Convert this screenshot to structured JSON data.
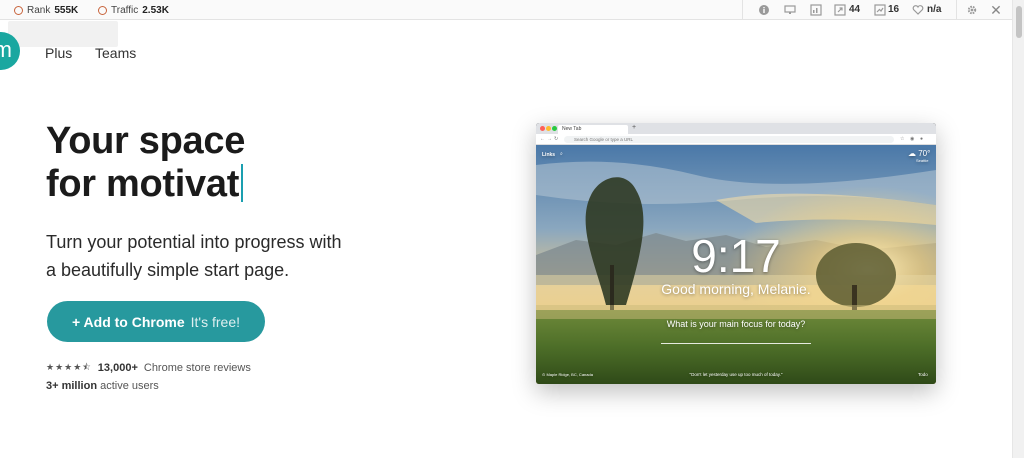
{
  "extension_bar": {
    "rank_label": "Rank",
    "rank_value": "555K",
    "traffic_label": "Traffic",
    "traffic_value": "2.53K",
    "count_a": "44",
    "count_b": "16",
    "na_value": "n/a"
  },
  "nav": {
    "logo_letter": "m",
    "links": [
      "Plus",
      "Teams"
    ]
  },
  "hero": {
    "title_line1": "Your space",
    "title_line2": "for motivat",
    "subtitle_line1": "Turn your potential into progress with",
    "subtitle_line2": "a beautifully simple start page.",
    "cta_main": "+ Add to Chrome",
    "cta_free": "It's free!",
    "reviews_count": "13,000+",
    "reviews_label": "Chrome store reviews",
    "users_count": "3+ million",
    "users_label": "active users",
    "rating": 4.5
  },
  "mockup": {
    "tab_title": "New Tab",
    "url_placeholder": "Search Google or type a URL",
    "links_label": "Links",
    "weather_temp": "70°",
    "weather_location": "Seattle",
    "clock": "9:17",
    "greeting": "Good morning, Melanie.",
    "focus_prompt": "What is your main focus for today?",
    "location_credit": "Maple Ridge, BC, Canada",
    "quote": "\"Don't let yesterday use up too much of today.\"",
    "todo_label": "Todo"
  },
  "colors": {
    "accent": "#27999e",
    "logo": "#1aa7a0",
    "caret": "#1a9fb0",
    "rank_ring": "#c8643c"
  }
}
